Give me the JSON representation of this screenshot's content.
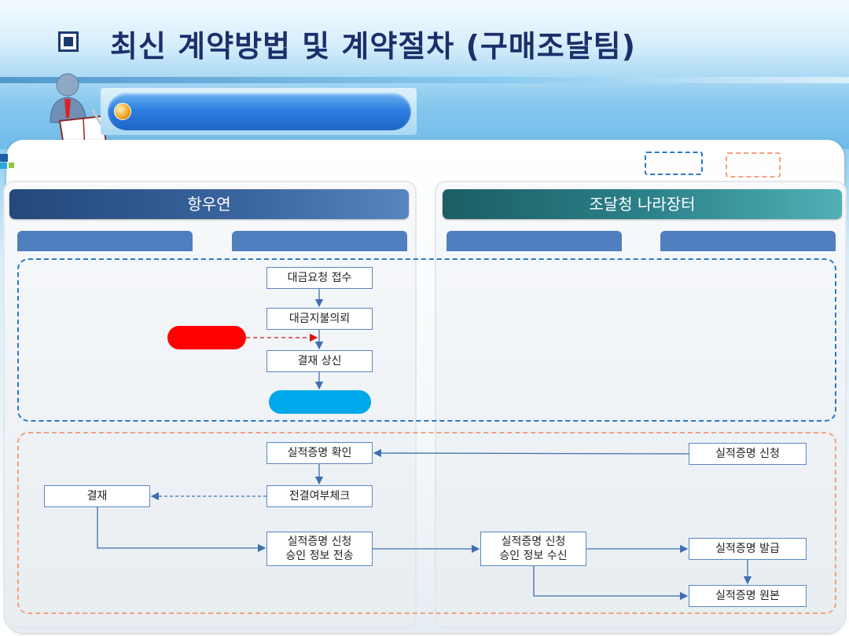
{
  "title": "최신 계약방법 및 계약절차 (구매조달팀)",
  "columns": {
    "left_header": "항우연",
    "right_header": "조달청 나라장터"
  },
  "flow_top": {
    "step1": "대금요청 접수",
    "step2": "대금지불의뢰",
    "step3": "결재 상신"
  },
  "flow_bottom": {
    "confirm": "실적증명 확인",
    "apply": "실적증명 신청",
    "approval": "결재",
    "check": "전결여부체크",
    "send_line1": "실적증명 신청",
    "send_line2": "승인 정보 전송",
    "receive_line1": "실적증명 신청",
    "receive_line2": "승인 정보 수신",
    "issue": "실적증명 발급",
    "original": "실적증명 원본"
  },
  "colors": {
    "blue_zone": "#2a78c8",
    "orange_zone": "#f4a07a",
    "red_marker": "#ff0000",
    "cyan_marker": "#00a8ec",
    "arrow": "#3f6fb0"
  }
}
